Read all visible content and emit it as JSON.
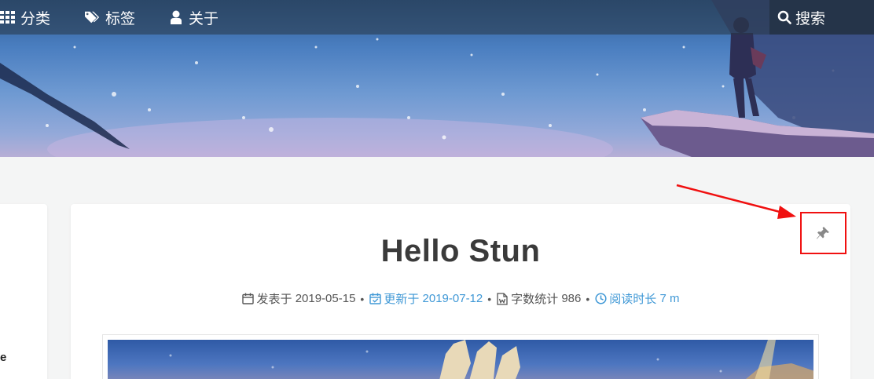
{
  "nav": {
    "items": [
      {
        "label": "分类",
        "icon": "th-grid-icon"
      },
      {
        "label": "标签",
        "icon": "tags-icon"
      },
      {
        "label": "关于",
        "icon": "user-icon"
      }
    ],
    "search_label": "搜索",
    "search_icon": "search-icon"
  },
  "side": {
    "fragment": "e"
  },
  "post": {
    "title": "Hello Stun",
    "meta": {
      "published_label": "发表于",
      "published_date": "2019-05-15",
      "updated_label": "更新于",
      "updated_date": "2019-07-12",
      "wordcount_label": "字数统计",
      "wordcount_value": "986",
      "readtime_label": "阅读时长",
      "readtime_value": "7 m",
      "separator": "•"
    },
    "pin_icon": "thumbtack-icon"
  },
  "colors": {
    "accent": "#3f98d6",
    "annotation": "#f01010",
    "title": "#3a3a3a"
  }
}
